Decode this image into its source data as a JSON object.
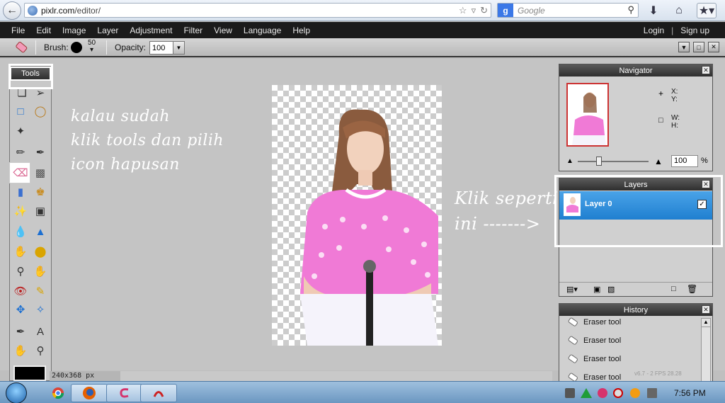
{
  "browser": {
    "url_domain": "pixlr.com",
    "url_path": "/editor/",
    "search_placeholder": "Google"
  },
  "menu": {
    "items": [
      "File",
      "Edit",
      "Image",
      "Layer",
      "Adjustment",
      "Filter",
      "View",
      "Language",
      "Help"
    ],
    "login": "Login",
    "separator": "|",
    "signup": "Sign up"
  },
  "options": {
    "brush_label": "Brush:",
    "brush_size": "50",
    "opacity_label": "Opacity:",
    "opacity_value": "100"
  },
  "tools_panel": {
    "title": "Tools"
  },
  "status": {
    "dimensions": "240x368 px"
  },
  "annotations": {
    "left_line1": "kalau sudah",
    "left_line2": "klik tools dan pilih",
    "left_line3": "icon hapusan",
    "right_line1": "Klik seperti",
    "right_line2": "ini ------->"
  },
  "navigator": {
    "title": "Navigator",
    "x_label": "X:",
    "y_label": "Y:",
    "w_label": "W:",
    "h_label": "H:",
    "zoom_value": "100",
    "zoom_unit": "%"
  },
  "layers": {
    "title": "Layers",
    "items": [
      {
        "name": "Layer 0",
        "visible": true
      }
    ]
  },
  "history": {
    "title": "History",
    "items": [
      "Eraser tool",
      "Eraser tool",
      "Eraser tool",
      "Eraser tool"
    ]
  },
  "fps_text": "v6.7 - 2 FPS 28.28",
  "taskbar": {
    "clock": "7:56 PM"
  },
  "colors": {
    "menubar": "#1b1b1b",
    "layer_selected": "#1f7fd0",
    "canvas_shirt": "#f07ad6"
  }
}
